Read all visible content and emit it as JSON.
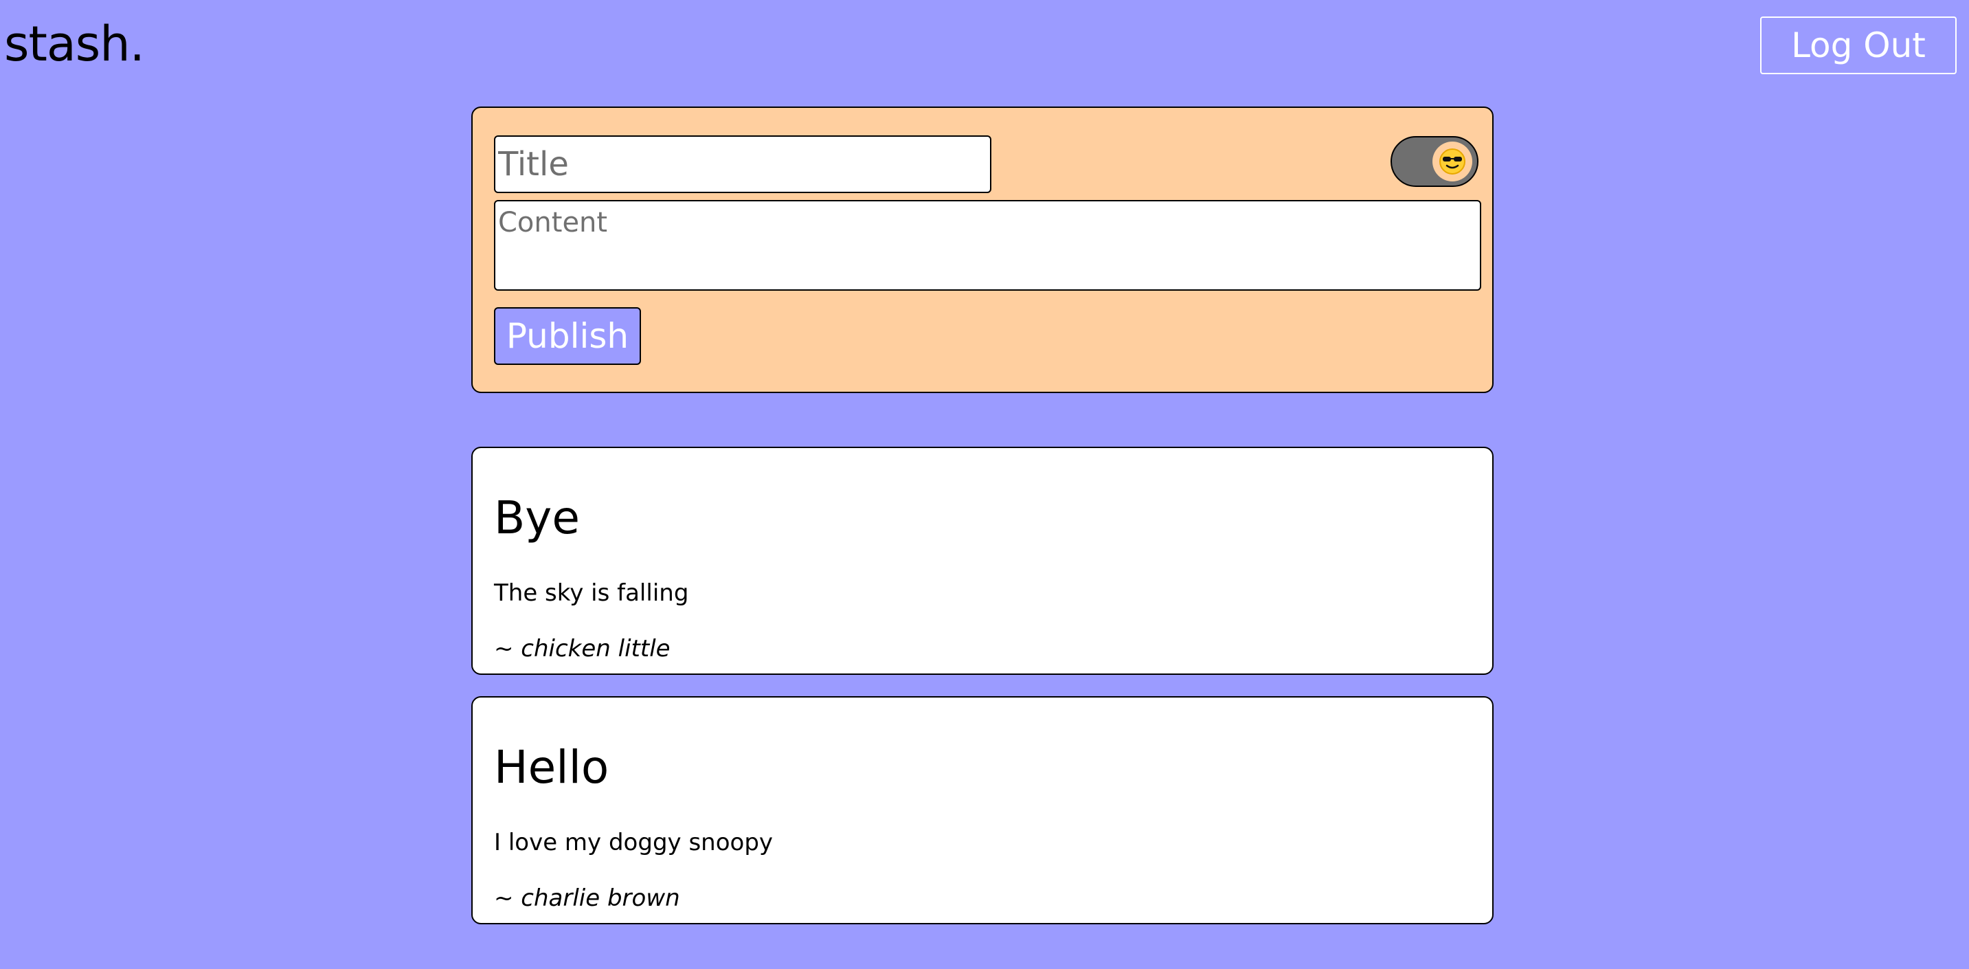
{
  "header": {
    "logo": "stash.",
    "logout_label": "Log Out"
  },
  "compose": {
    "title_placeholder": "Title",
    "content_placeholder": "Content",
    "publish_label": "Publish",
    "toggle_icon": "sunglasses-face-emoji"
  },
  "posts": [
    {
      "title": "Bye",
      "content": "The sky is falling",
      "author": "~ chicken little"
    },
    {
      "title": "Hello",
      "content": "I love my doggy snoopy",
      "author": "~ charlie brown"
    }
  ],
  "colors": {
    "background": "#9b9bff",
    "compose_card": "#ffcf9f",
    "toggle_track": "#6f6f6f",
    "post_card": "#ffffff"
  }
}
